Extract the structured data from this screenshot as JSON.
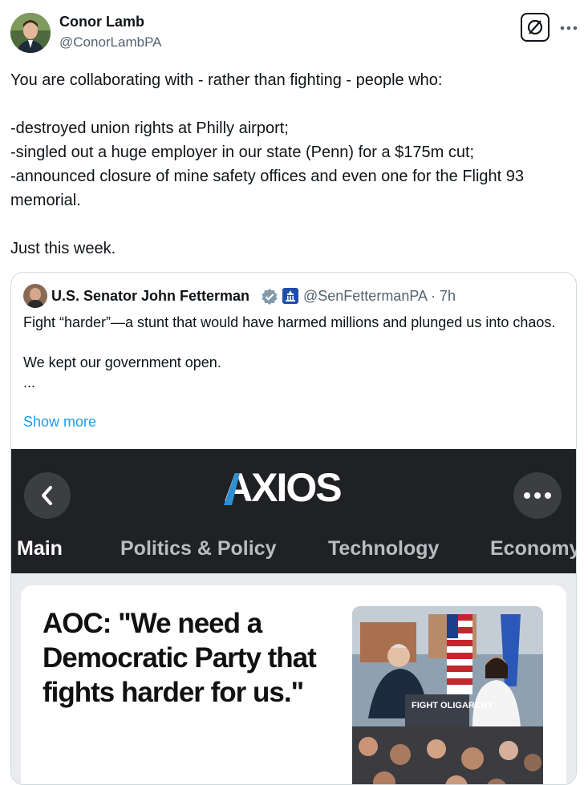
{
  "post": {
    "author_name": "Conor Lamb",
    "author_handle": "@ConorLambPA",
    "text": "You are collaborating with - rather than fighting - people who:\n\n-destroyed union rights at Philly airport;\n-singled out a huge employer in our state (Penn) for a $175m cut;\n-announced closure of mine safety offices and even one for the Flight 93 memorial.\n\nJust this week."
  },
  "quote": {
    "author_name": "U.S. Senator John Fetterman",
    "author_handle": "@SenFettermanPA · 7h",
    "text": "Fight “harder”—a stunt that would have harmed millions and plunged us into chaos.\n\nWe kept our government open.\n...",
    "show_more": "Show more"
  },
  "media": {
    "app_logo": "AXIOS",
    "tabs": [
      "Main",
      "Politics & Policy",
      "Technology",
      "Economy"
    ],
    "active_tab": "Main",
    "headline": "AOC: \"We need a Democratic Party that fights harder for us.\"",
    "photo_sign": "FIGHT OLIGARCHY"
  },
  "icons": {
    "grok": "grok-icon",
    "more": "more-horizontal-icon",
    "verified": "verified-badge-icon",
    "affiliation": "capitol-building-icon",
    "back": "chevron-left-icon",
    "menu": "more-dots-icon"
  },
  "colors": {
    "link": "#1d9bf0",
    "verified": "#829aab",
    "axios_bar": "#1f2124",
    "axios_blue": "#2f8fd1"
  }
}
